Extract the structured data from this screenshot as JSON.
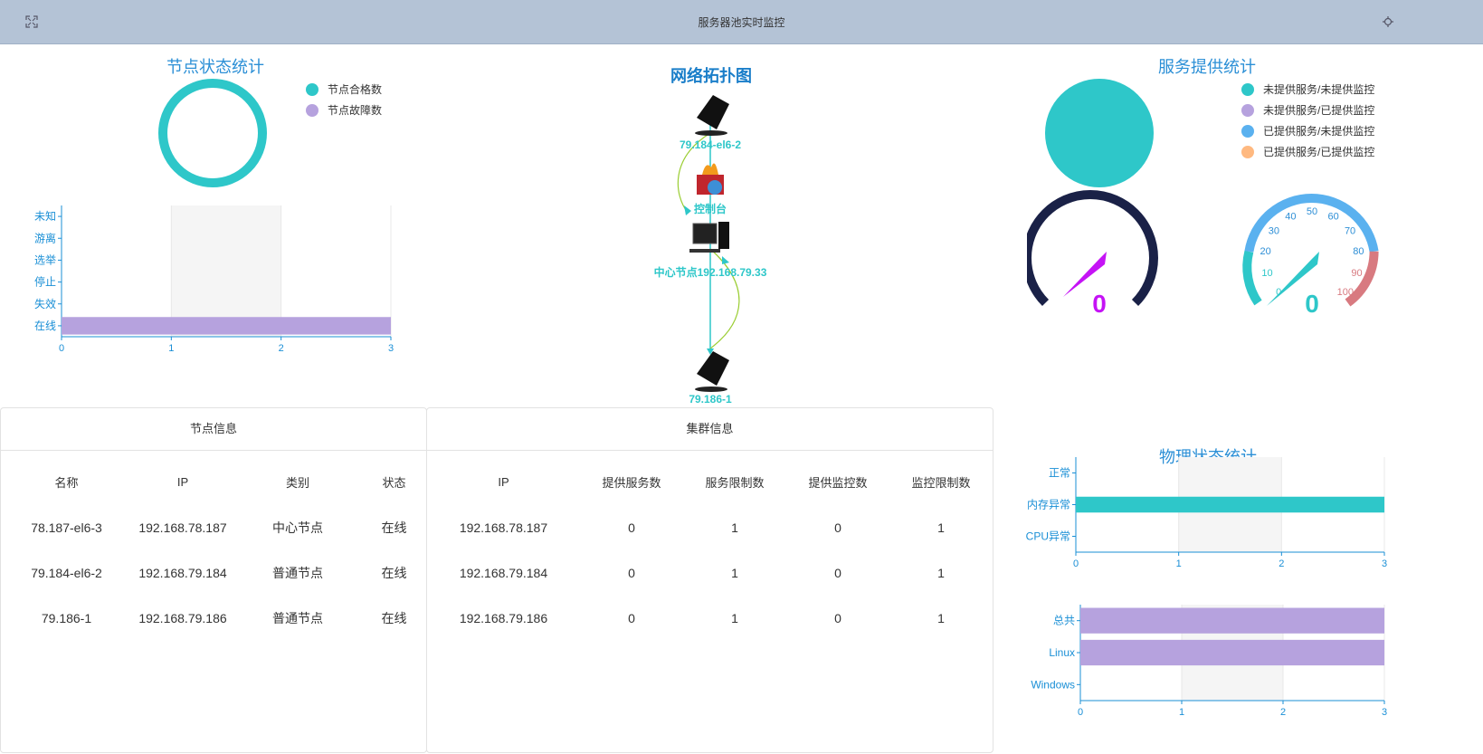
{
  "header": {
    "title": "服务器池实时监控",
    "left_icon": "fullscreen-icon",
    "right_icon": "settings-icon"
  },
  "node_status": {
    "title": "节点状态统计",
    "legend": [
      {
        "label": "节点合格数",
        "color": "#2ec7c9"
      },
      {
        "label": "节点故障数",
        "color": "#b6a2de"
      }
    ],
    "ring_values": {
      "qualified": 3,
      "faulty": 0
    },
    "chart_data": {
      "type": "bar",
      "categories": [
        "未知",
        "游离",
        "选举",
        "停止",
        "失效",
        "在线"
      ],
      "values": [
        0,
        0,
        0,
        0,
        0,
        3
      ],
      "xlim": [
        0,
        3
      ],
      "xticks": [
        "0",
        "1",
        "2",
        "3"
      ],
      "bar_color": "#b6a2de"
    }
  },
  "topology": {
    "title": "网络拓扑图",
    "nodes": [
      {
        "label": "79.184-el6-2",
        "icon": "server-icon"
      },
      {
        "label": "控制台",
        "icon": "firewall-icon"
      },
      {
        "label": "中心节点192.168.79.33",
        "icon": "desktop-computer-icon"
      },
      {
        "label": "79.186-1",
        "icon": "server-icon"
      }
    ]
  },
  "service": {
    "title": "服务提供统计",
    "legend": [
      {
        "label": "未提供服务/未提供监控",
        "color": "#2ec7c9"
      },
      {
        "label": "未提供服务/已提供监控",
        "color": "#b6a2de"
      },
      {
        "label": "已提供服务/未提供监控",
        "color": "#5ab1ef"
      },
      {
        "label": "已提供服务/已提供监控",
        "color": "#ffb980"
      }
    ],
    "pie_values": [
      3,
      0,
      0,
      0
    ],
    "gauge_left": {
      "value": "0",
      "color": "#c513f5"
    },
    "gauge_right": {
      "value": "0",
      "ticks": [
        "0",
        "10",
        "20",
        "30",
        "40",
        "50",
        "60",
        "70",
        "80",
        "90",
        "100"
      ],
      "color": "#2ec7c9"
    }
  },
  "node_info": {
    "title": "节点信息",
    "columns": [
      "名称",
      "IP",
      "类别",
      "状态"
    ],
    "rows": [
      [
        "78.187-el6-3",
        "192.168.78.187",
        "中心节点",
        "在线"
      ],
      [
        "79.184-el6-2",
        "192.168.79.184",
        "普通节点",
        "在线"
      ],
      [
        "79.186-1",
        "192.168.79.186",
        "普通节点",
        "在线"
      ]
    ]
  },
  "cluster_info": {
    "title": "集群信息",
    "columns": [
      "IP",
      "提供服务数",
      "服务限制数",
      "提供监控数",
      "监控限制数"
    ],
    "rows": [
      [
        "192.168.78.187",
        "0",
        "1",
        "0",
        "1"
      ],
      [
        "192.168.79.184",
        "0",
        "1",
        "0",
        "1"
      ],
      [
        "192.168.79.186",
        "0",
        "1",
        "0",
        "1"
      ]
    ]
  },
  "physical": {
    "title": "物理状态统计",
    "chart_data": [
      {
        "type": "bar",
        "categories": [
          "正常",
          "内存异常",
          "CPU异常"
        ],
        "values": [
          0,
          3,
          0
        ],
        "xlim": [
          0,
          3
        ],
        "xticks": [
          "0",
          "1",
          "2",
          "3"
        ],
        "bar_color": "#2ec7c9"
      },
      {
        "type": "bar",
        "categories": [
          "总共",
          "Linux",
          "Windows"
        ],
        "values": [
          3,
          3,
          0
        ],
        "xlim": [
          0,
          3
        ],
        "xticks": [
          "0",
          "1",
          "2",
          "3"
        ],
        "bar_color": "#b6a2de"
      }
    ]
  }
}
